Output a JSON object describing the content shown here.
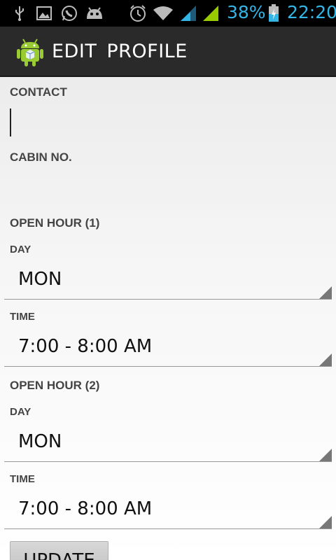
{
  "status_bar": {
    "icons": [
      "usb-icon",
      "image-icon",
      "whatsapp-icon",
      "android-debug-icon",
      "alarm-icon",
      "wifi-icon",
      "signal-1-icon",
      "signal-2-icon",
      "battery-charging-icon"
    ],
    "battery_percent": "38%",
    "time": "22:20",
    "accent_color": "#33b5e5"
  },
  "action_bar": {
    "app_icon": "android-app-icon",
    "title": "EDIT  PROFILE"
  },
  "form": {
    "contact_label": "CONTACT",
    "contact_value": "",
    "cabin_label": "CABIN NO.",
    "cabin_value": "",
    "open_hour_1": {
      "heading": "OPEN HOUR (1)",
      "day_label": "DAY",
      "day_value": "MON",
      "time_label": "TIME",
      "time_value": "7:00 - 8:00 AM"
    },
    "open_hour_2": {
      "heading": "OPEN HOUR (2)",
      "day_label": "DAY",
      "day_value": "MON",
      "time_label": "TIME",
      "time_value": "7:00 - 8:00 AM"
    },
    "update_button": "UPDATE"
  }
}
